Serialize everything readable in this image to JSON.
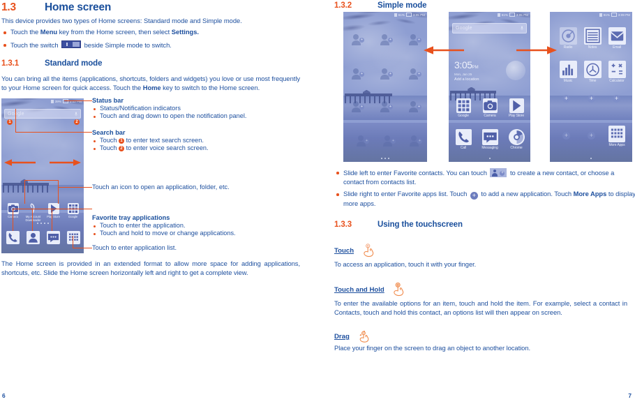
{
  "meta": {
    "accent_orange": "#e8511d",
    "text_blue": "#1d4f9e",
    "left_page_number": "6",
    "right_page_number": "7"
  },
  "left_column": {
    "section": {
      "number": "1.3",
      "title": "Home screen"
    },
    "intro": "This device provides two types of Home screens: Standard mode and Simple mode.",
    "bullets": [
      {
        "pre": "Touch the ",
        "bold1": "Menu",
        "mid": " key from the Home screen, then select ",
        "bold2": "Settings."
      },
      {
        "pre": "Touch the switch ",
        "post": " beside Simple mode to switch."
      }
    ],
    "subsection": {
      "number": "1.3.1",
      "title": "Standard mode"
    },
    "standard_paragraph_a": "You can bring all the items (applications, shortcuts, folders and widgets) you love or use most frequently to your Home screen for quick access. Touch the ",
    "standard_paragraph_home": "Home",
    "standard_paragraph_b": " key to switch to the Home screen.",
    "callouts": [
      {
        "title": "Status bar",
        "items": [
          "Status/Notification indicators",
          "Touch and drag down to open the notification panel."
        ]
      },
      {
        "title": "Search bar",
        "items_pre": [
          "Touch ",
          "Touch "
        ],
        "items_post": [
          " to enter text search screen.",
          " to enter voice search screen."
        ],
        "badges": [
          "1",
          "2"
        ]
      }
    ],
    "callout_icon_line": "Touch an icon to open an application, folder, etc.",
    "callout_tray": {
      "title": "Favorite tray applications",
      "items": [
        "Touch to enter the application.",
        "Touch and hold to move or change applications."
      ]
    },
    "callout_applist": "Touch to enter application list.",
    "closing_paragraph": "The Home screen is provided in an extended format to allow more space for adding applications, shortcuts, etc. Slide the Home screen horizontally left and right to get a complete view.",
    "phone_standard": {
      "status_battery": "39%",
      "status_time": "3:02 PM",
      "search_placeholder": "Google",
      "badge1": "1",
      "badge2": "2",
      "apps": [
        {
          "label": "Camera",
          "icon": "camera-icon"
        },
        {
          "label": "My Account",
          "sub": "Downloader",
          "icon": "account-icon"
        },
        {
          "label": "Play Store",
          "icon": "play-store-icon"
        },
        {
          "label": "Google",
          "icon": "google-folder-icon"
        }
      ],
      "tray": [
        {
          "label": "",
          "icon": "phone-icon"
        },
        {
          "label": "",
          "icon": "contacts-icon"
        },
        {
          "label": "",
          "icon": "messaging-icon"
        },
        {
          "label": "",
          "icon": "app-list-icon"
        }
      ]
    }
  },
  "right_column": {
    "subsection_simple": {
      "number": "1.3.2",
      "title": "Simple mode"
    },
    "phones": {
      "favorite_contacts": {
        "status_battery": "61%",
        "status_time": "3:05 PM",
        "contact_count": 9
      },
      "home": {
        "status_battery": "61%",
        "status_time": "3:05 PM",
        "search_placeholder": "Google",
        "clock_time": "3:05",
        "clock_ampm": "PM",
        "clock_date": "Mon,  Jan 25",
        "clock_location": "Add a location",
        "apps": [
          {
            "label": "Google",
            "icon": "google-folder-icon"
          },
          {
            "label": "Camera",
            "icon": "camera-icon"
          },
          {
            "label": "Play Store",
            "icon": "play-store-icon"
          }
        ],
        "tray": [
          {
            "label": "Call",
            "icon": "phone-icon"
          },
          {
            "label": "Messaging",
            "icon": "messaging-icon"
          },
          {
            "label": "Chrome",
            "icon": "chrome-icon"
          }
        ]
      },
      "favorite_apps": {
        "status_battery": "61%",
        "status_time": "3:09 PM",
        "apps": [
          {
            "label": "Radio",
            "icon": "radio-icon"
          },
          {
            "label": "Notes",
            "icon": "notes-icon"
          },
          {
            "label": "Email",
            "icon": "email-icon"
          },
          {
            "label": "Music",
            "icon": "music-icon"
          },
          {
            "label": "Time",
            "icon": "clock-icon"
          },
          {
            "label": "Calculator",
            "icon": "calculator-icon"
          }
        ],
        "more_apps_label": "More Apps",
        "add_slots": 5
      }
    },
    "bullets": [
      {
        "pre": "Slide left to enter Favorite contacts. You can touch ",
        "post": " to create a new contact, or choose a contact from contacts list."
      },
      {
        "pre": "Slide right to enter Favorite apps list. Touch ",
        "mid": " to add a new application. Touch ",
        "bold": "More Apps",
        "post": " to display more apps."
      }
    ],
    "subsection_touchscreen": {
      "number": "1.3.3",
      "title": "Using the touchscreen"
    },
    "gestures": [
      {
        "name": "Touch",
        "icon": "touch-hand-icon",
        "desc": "To access an application, touch it with your finger."
      },
      {
        "name": "Touch and Hold",
        "icon": "touch-hold-hand-icon",
        "desc": "To enter the available options for an item, touch and hold the item. For example, select a contact in Contacts, touch and hold this contact, an options list will then appear on screen."
      },
      {
        "name": "Drag",
        "icon": "drag-hand-icon",
        "desc": "Place your finger on the screen to drag an object to another location."
      }
    ]
  }
}
